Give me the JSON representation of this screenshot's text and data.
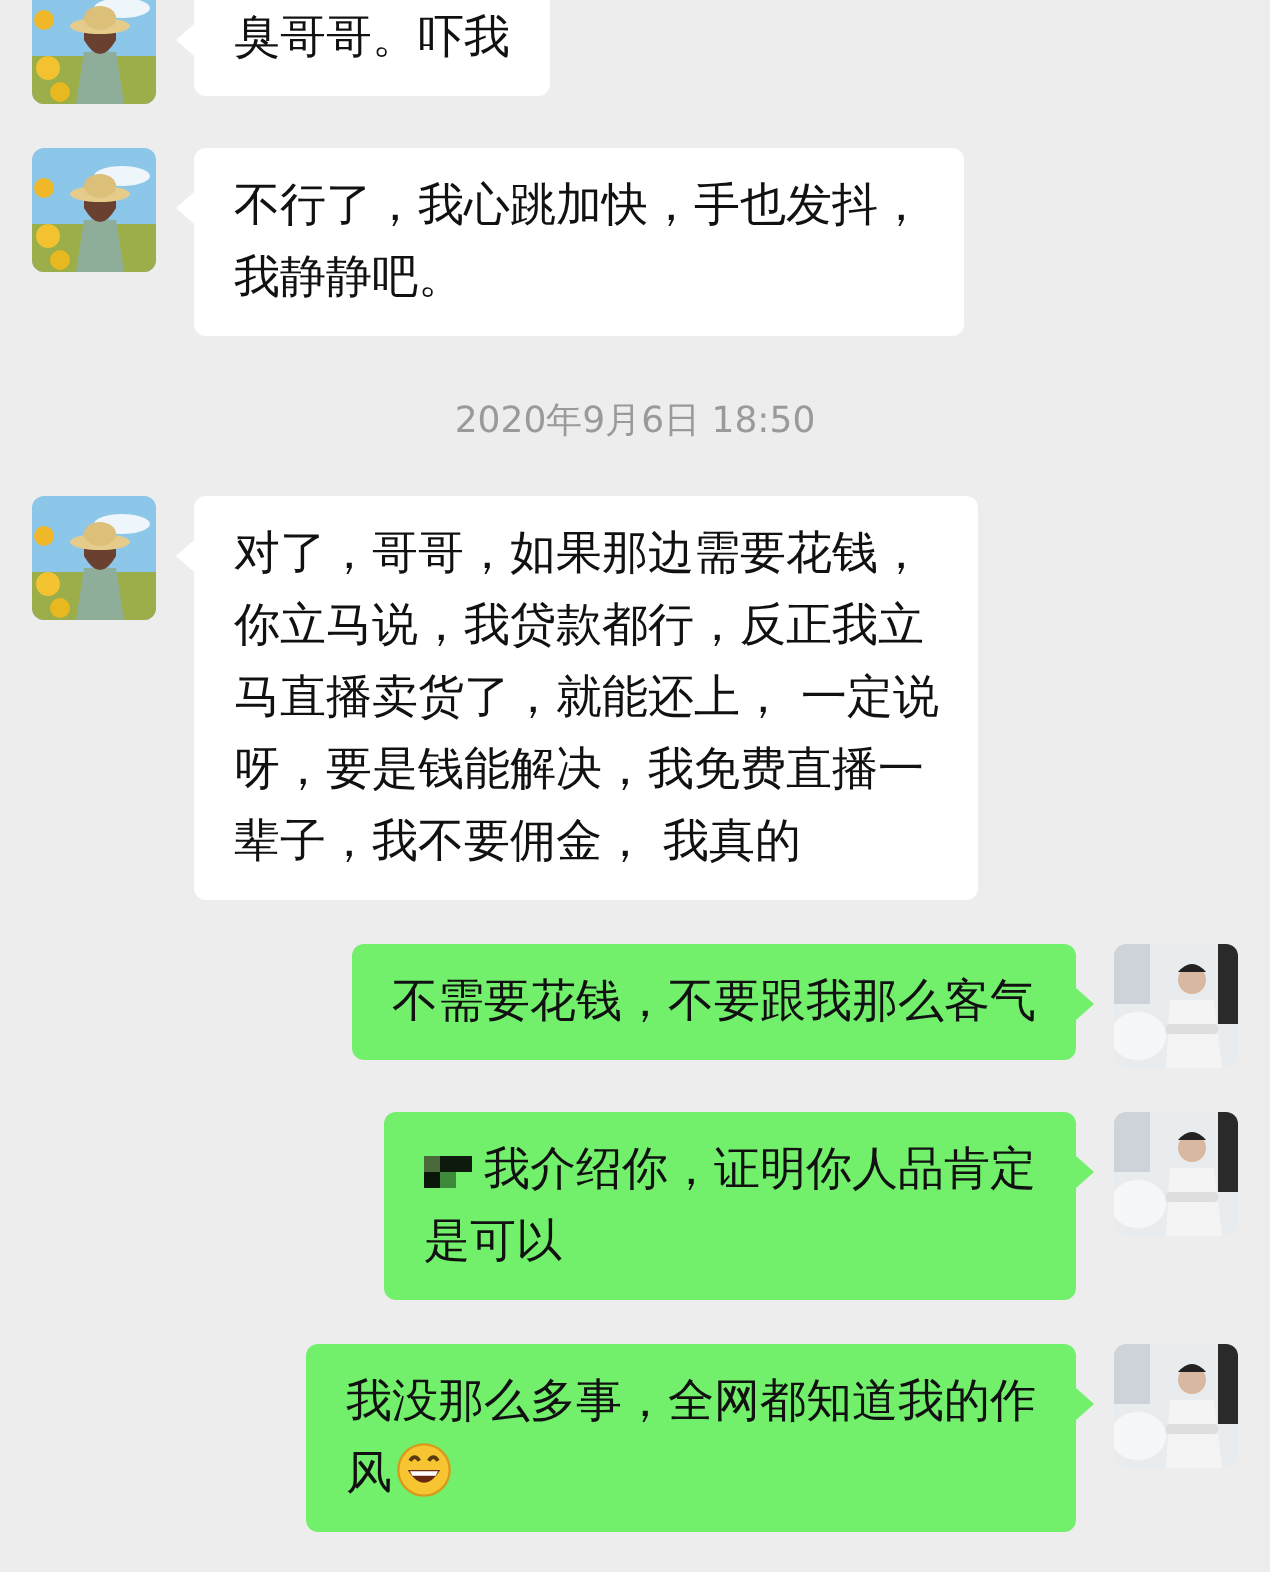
{
  "messages": [
    {
      "kind": "text",
      "outgoing": false,
      "lines": [
        "臭哥哥。吓我"
      ]
    },
    {
      "kind": "text",
      "outgoing": false,
      "lines": [
        "不行了，我心跳加快，手也发抖，",
        "我静静吧。"
      ]
    },
    {
      "kind": "time",
      "text": "2020年9月6日 18:50"
    },
    {
      "kind": "text",
      "outgoing": false,
      "lines": [
        "对了，哥哥，如果那边需要花钱，",
        "你立马说，我贷款都行，反正我立",
        "马直播卖货了，就能还上， 一定说",
        "呀，要是钱能解决，我免费直播一",
        "辈子，我不要佣金， 我真的"
      ]
    },
    {
      "kind": "text",
      "outgoing": true,
      "lines": [
        "不需要花钱，不要跟我那么客气"
      ]
    },
    {
      "kind": "text",
      "outgoing": true,
      "redacted": true,
      "lines": [
        "我介绍你，证明你人品肯定",
        "是可以"
      ]
    },
    {
      "kind": "text",
      "outgoing": true,
      "ends_with_emoji": true,
      "lines": [
        "我没那么多事，全网都知道我的作",
        "风"
      ]
    }
  ]
}
